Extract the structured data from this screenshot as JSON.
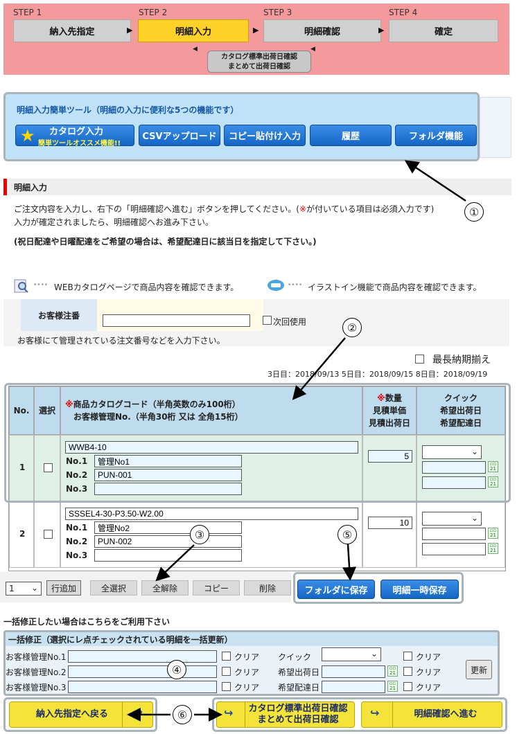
{
  "steps": [
    {
      "label": "STEP 1",
      "name": "納入先指定"
    },
    {
      "label": "STEP 2",
      "name": "明細入力"
    },
    {
      "label": "STEP 3",
      "name": "明細確認"
    },
    {
      "label": "STEP 4",
      "name": "確定"
    }
  ],
  "step_sub_button": {
    "line1": "カタログ標準出荷日確認",
    "line2": "まとめて出荷日確認"
  },
  "tools": {
    "title": "明細入力簡単ツール（明細の入力に便利な5つの機能です）",
    "catalog_label": "カタログ入力",
    "catalog_sub": "簡単ツールオススメ機能!!",
    "csv_label": "CSVアップロード",
    "copy_label": "コピー貼付け入力",
    "history_label": "履歴",
    "folder_label": "フォルダ機能"
  },
  "section": {
    "title": "明細入力"
  },
  "instructions": {
    "line1_a": "ご注文内容を入力し、右下の「明細確認へ進む」ボタンを押してください。(",
    "line1_red": "※",
    "line1_b": "が付いている項目は必須入力です)",
    "line2": "入力が確定されましたら、明細確認へお進み下さい。",
    "line3": "(祝日配達や日曜配達をご希望の場合は、希望配達日に該当日を指定して下さい。)"
  },
  "hints": {
    "web": "WEBカタログページで商品内容を確認できます。",
    "illust": "イラストイン機能で商品内容を確認できます。"
  },
  "customer": {
    "label": "お客様注番",
    "value": "",
    "next_use": "次回使用",
    "note": "お客様にて管理されている注文番号などを入力下さい。"
  },
  "longest": {
    "label": "最長納期揃え",
    "dates": "3日目：2018/09/13  5日目：2018/09/15  8日目：2018/09/19"
  },
  "table": {
    "h_no": "No.",
    "h_select": "選択",
    "h_code_mark": "※",
    "h_code": "商品カタログコード（半角英数のみ100桁）",
    "h_code2": "お客様管理No.（半角30桁 又は 全角15桁）",
    "h_qty_mark": "※",
    "h_qty": "数量",
    "h_qty2": "見積単価",
    "h_qty3": "見積出荷日",
    "h_quick": "クイック",
    "h_quick2": "希望出荷日",
    "h_quick3": "希望配達日",
    "no1_label": "No.1",
    "no2_label": "No.2",
    "no3_label": "No.3",
    "rows": [
      {
        "no": "1",
        "code": "WWB4-10",
        "no1": "管理No1",
        "no2": "PUN-001",
        "no3": "",
        "qty": "5"
      },
      {
        "no": "2",
        "code": "SSSEL4-30-P3.50-W2.00",
        "no1": "管理No2",
        "no2": "PUN-002",
        "no3": "",
        "qty": "10"
      }
    ]
  },
  "actions": {
    "row_count": "1",
    "add_row": "行追加",
    "select_all": "全選択",
    "deselect_all": "全解除",
    "copy": "コピー",
    "delete": "削除",
    "save_folder": "フォルダに保存",
    "temp_save": "明細一時保存"
  },
  "bulk": {
    "intro": "一括修正したい場合はこちらをご利用下さい",
    "title": "一括修正（選択にレ点チェックされている明細を一括更新）",
    "mgmt1": "お客様管理No.1",
    "mgmt2": "お客様管理No.2",
    "mgmt3": "お客様管理No.3",
    "clear": "クリア",
    "quick": "クイック",
    "ship_date": "希望出荷日",
    "delivery_date": "希望配達日",
    "update": "更新"
  },
  "bottom": {
    "back": "納入先指定へ戻る",
    "check_line1": "カタログ標準出荷日確認",
    "check_line2": "まとめて出荷日確認",
    "next": "明細確認へ進む"
  },
  "callouts": [
    "①",
    "②",
    "③",
    "④",
    "⑤",
    "⑥"
  ],
  "cal_icon": {
    "top": "▫▫",
    "num": "21"
  }
}
